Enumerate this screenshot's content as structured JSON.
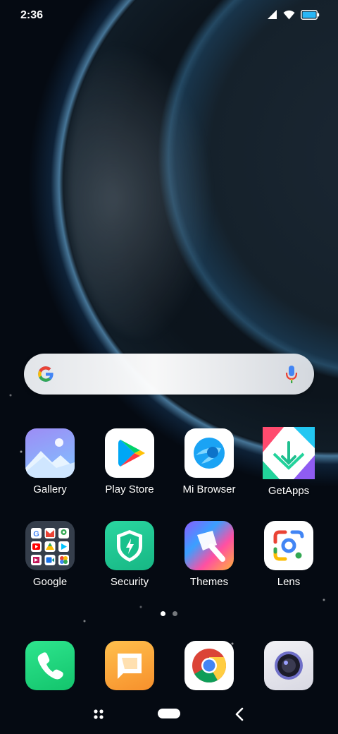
{
  "status_bar": {
    "time": "2:36"
  },
  "search_bar": {
    "provider": "Google"
  },
  "home_apps": [
    {
      "label": "Gallery"
    },
    {
      "label": "Play Store"
    },
    {
      "label": "Mi Browser"
    },
    {
      "label": "GetApps"
    },
    {
      "label": "Google"
    },
    {
      "label": "Security"
    },
    {
      "label": "Themes"
    },
    {
      "label": "Lens"
    }
  ],
  "page_indicator": {
    "pages": 2,
    "current": 1
  },
  "dock": [
    "phone-icon",
    "messages-icon",
    "chrome-icon",
    "camera-icon"
  ],
  "navigation": [
    "menu-icon",
    "home-pill",
    "back-icon"
  ],
  "colors": {
    "accent_green": "#1fd07c",
    "security_green": "#1fc28d",
    "messages_orange": "#f7a53a"
  }
}
